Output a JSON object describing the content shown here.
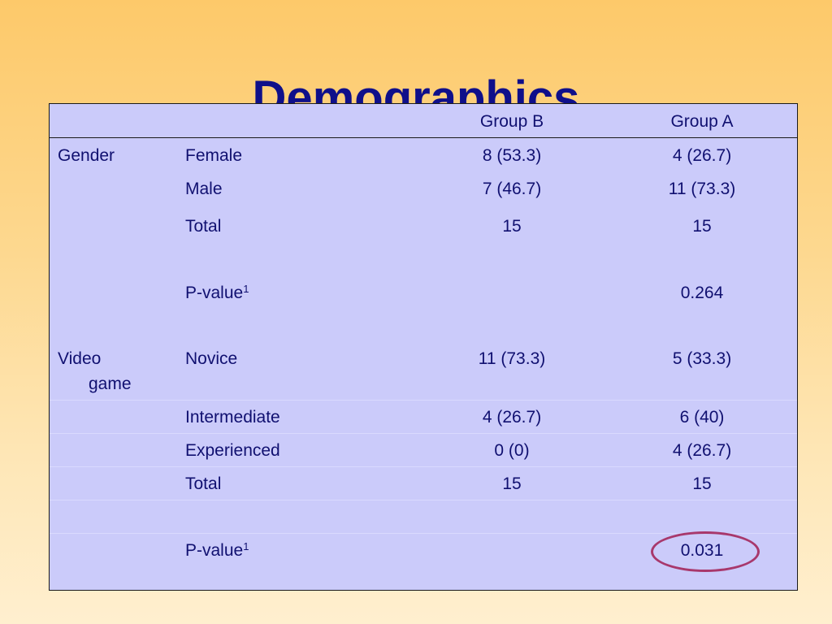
{
  "slide": {
    "title": "Demographics"
  },
  "table": {
    "columns": [
      "",
      "",
      "Group B",
      "Group A"
    ],
    "rows": [
      {
        "category": "Gender",
        "label": "Female",
        "group_b": "8 (53.3)",
        "group_a": "4 (26.7)"
      },
      {
        "category": "",
        "label": "Male",
        "group_b": "7 (46.7)",
        "group_a": "11 (73.3)"
      },
      {
        "category": "",
        "label": "Total",
        "group_b": "15",
        "group_a": "15"
      },
      {
        "category": "",
        "label": "P-value",
        "superscript": "1",
        "group_b": "",
        "group_a": "0.264"
      },
      {
        "category": "Video game",
        "category_line1": "Video",
        "category_line2": "game",
        "label": "Novice",
        "group_b": "11 (73.3)",
        "group_a": "5 (33.3)"
      },
      {
        "category": "",
        "label": "Intermediate",
        "group_b": "4 (26.7)",
        "group_a": "6 (40)"
      },
      {
        "category": "",
        "label": "Experienced",
        "group_b": "0 (0)",
        "group_a": "4 (26.7)"
      },
      {
        "category": "",
        "label": "Total",
        "group_b": "15",
        "group_a": "15"
      },
      {
        "category": "",
        "label": "P-value",
        "superscript": "1",
        "group_b": "",
        "group_a": "0.031",
        "highlighted": true
      }
    ]
  },
  "colors": {
    "title": "#0f0f8a",
    "text": "#101070",
    "table_fill": "#cbcbfa",
    "highlight": "#a8386c",
    "background_top": "#fdc96a",
    "background_bottom": "#ffefcf"
  }
}
